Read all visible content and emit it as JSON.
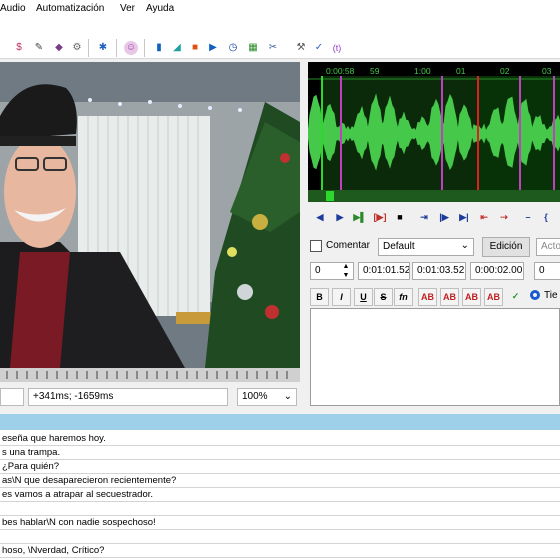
{
  "menu": [
    "Audio",
    "Automatización",
    "Ver",
    "Ayuda"
  ],
  "audio": {
    "ruler_labels": [
      "0:00:58",
      "59",
      "1:00",
      "01",
      "02",
      "03"
    ]
  },
  "video": {
    "offset_text": "+341ms; -1659ms",
    "zoom": "100%"
  },
  "edit": {
    "comment_label": "Comentar",
    "style": "Default",
    "edition_button": "Edición",
    "actor_placeholder": "Acto",
    "layer": "0",
    "start_time": "0:01:01.52",
    "end_time": "0:01:03.52",
    "duration": "0:00:02.00",
    "margin": "0",
    "format_buttons": [
      "B",
      "I",
      "U",
      "S",
      "fn",
      "AB",
      "AB",
      "AB",
      "AB",
      "✓"
    ],
    "time_radio_label": "Tie"
  },
  "subtitles": [
    "eseña que haremos hoy.",
    "s una trampa.",
    "¿Para quién?",
    "as\\N que desaparecieron recientemente?",
    "es vamos a atrapar al secuestrador.",
    "",
    "bes hablar\\N con nadie sospechoso!",
    "",
    "hoso, \\Nverdad, Crítico?"
  ]
}
